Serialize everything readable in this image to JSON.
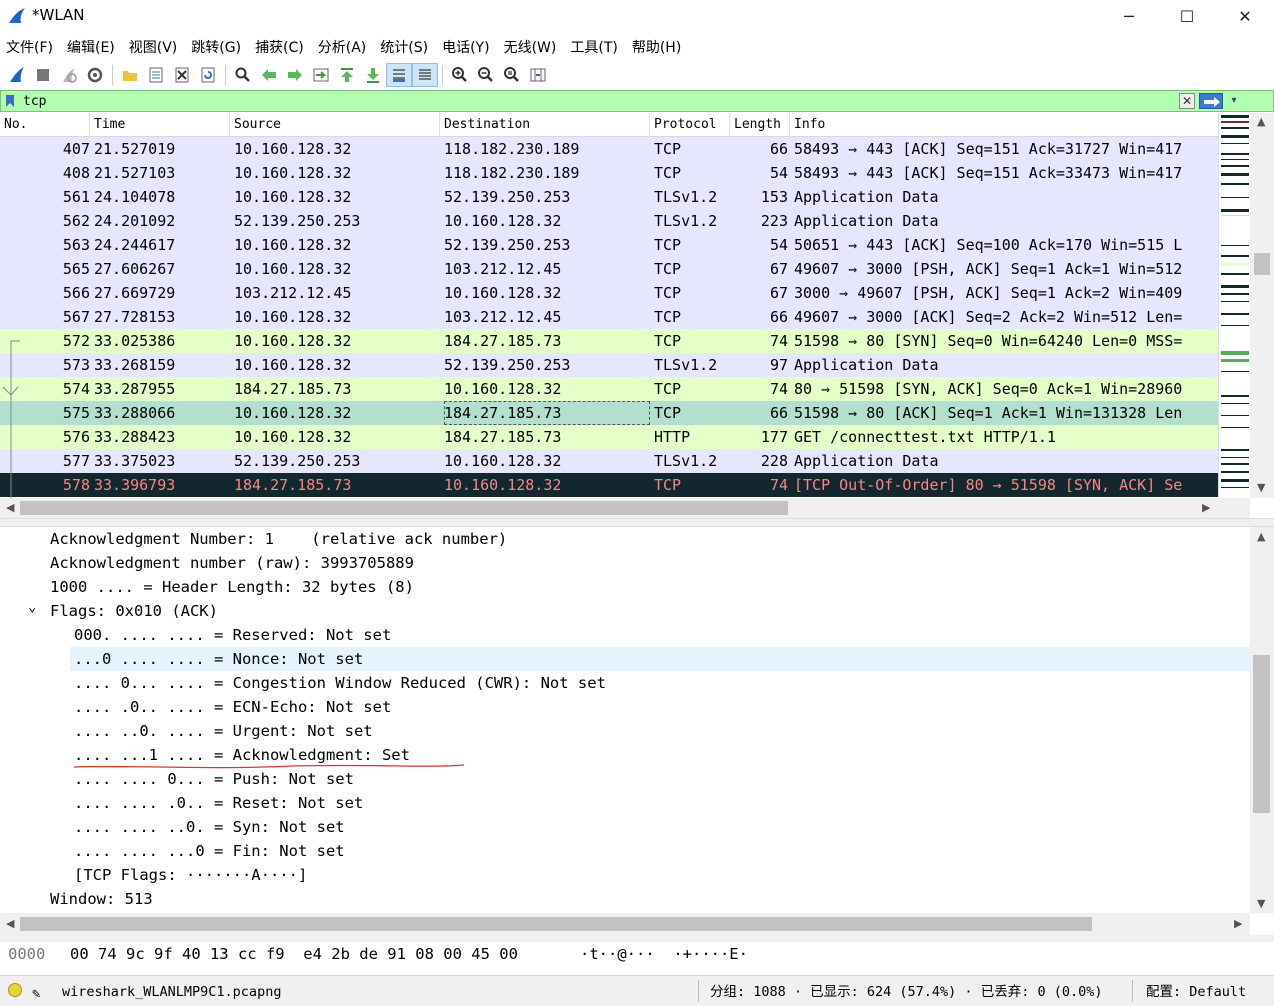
{
  "window": {
    "title": "*WLAN",
    "minimize": "─",
    "maximize": "☐",
    "close": "✕"
  },
  "menu": [
    "文件(F)",
    "编辑(E)",
    "视图(V)",
    "跳转(G)",
    "捕获(C)",
    "分析(A)",
    "统计(S)",
    "电话(Y)",
    "无线(W)",
    "工具(T)",
    "帮助(H)"
  ],
  "toolbar": [
    "shark-fin-start-icon",
    "stop-square-icon",
    "restart-fin-icon",
    "capture-options-gear-icon",
    "open-folder-icon",
    "save-file-icon",
    "close-file-icon",
    "reload-icon",
    "find-magnifier-icon",
    "go-back-arrow-icon",
    "go-forward-arrow-icon",
    "go-to-packet-icon",
    "go-first-icon",
    "go-last-icon",
    "autoscroll-icon",
    "colorize-icon",
    "zoom-in-icon",
    "zoom-out-icon",
    "zoom-normal-icon",
    "resize-columns-icon"
  ],
  "filter": {
    "value": "tcp",
    "clear": "✕",
    "dropdown": "▾"
  },
  "columns": [
    "No.",
    "Time",
    "Source",
    "Destination",
    "Protocol",
    "Length",
    "Info"
  ],
  "packets": [
    {
      "no": "407",
      "time": "21.527019",
      "src": "10.160.128.32",
      "dst": "118.182.230.189",
      "proto": "TCP",
      "len": "66",
      "info": "58493 → 443 [ACK] Seq=151 Ack=31727 Win=417",
      "cls": "r-tcp"
    },
    {
      "no": "408",
      "time": "21.527103",
      "src": "10.160.128.32",
      "dst": "118.182.230.189",
      "proto": "TCP",
      "len": "54",
      "info": "58493 → 443 [ACK] Seq=151 Ack=33473 Win=417",
      "cls": "r-tcp"
    },
    {
      "no": "561",
      "time": "24.104078",
      "src": "10.160.128.32",
      "dst": "52.139.250.253",
      "proto": "TLSv1.2",
      "len": "153",
      "info": "Application Data",
      "cls": "r-tls"
    },
    {
      "no": "562",
      "time": "24.201092",
      "src": "52.139.250.253",
      "dst": "10.160.128.32",
      "proto": "TLSv1.2",
      "len": "223",
      "info": "Application Data",
      "cls": "r-tls"
    },
    {
      "no": "563",
      "time": "24.244617",
      "src": "10.160.128.32",
      "dst": "52.139.250.253",
      "proto": "TCP",
      "len": "54",
      "info": "50651 → 443 [ACK] Seq=100 Ack=170 Win=515 L",
      "cls": "r-tcp"
    },
    {
      "no": "565",
      "time": "27.606267",
      "src": "10.160.128.32",
      "dst": "103.212.12.45",
      "proto": "TCP",
      "len": "67",
      "info": "49607 → 3000 [PSH, ACK] Seq=1 Ack=1 Win=512",
      "cls": "r-tcp"
    },
    {
      "no": "566",
      "time": "27.669729",
      "src": "103.212.12.45",
      "dst": "10.160.128.32",
      "proto": "TCP",
      "len": "67",
      "info": "3000 → 49607 [PSH, ACK] Seq=1 Ack=2 Win=409",
      "cls": "r-tcp"
    },
    {
      "no": "567",
      "time": "27.728153",
      "src": "10.160.128.32",
      "dst": "103.212.12.45",
      "proto": "TCP",
      "len": "66",
      "info": "49607 → 3000 [ACK] Seq=2 Ack=2 Win=512 Len=",
      "cls": "r-tcp"
    },
    {
      "no": "572",
      "time": "33.025386",
      "src": "10.160.128.32",
      "dst": "184.27.185.73",
      "proto": "TCP",
      "len": "74",
      "info": "51598 → 80 [SYN] Seq=0 Win=64240 Len=0 MSS=",
      "cls": "r-syn"
    },
    {
      "no": "573",
      "time": "33.268159",
      "src": "10.160.128.32",
      "dst": "52.139.250.253",
      "proto": "TLSv1.2",
      "len": "97",
      "info": "Application Data",
      "cls": "r-tls"
    },
    {
      "no": "574",
      "time": "33.287955",
      "src": "184.27.185.73",
      "dst": "10.160.128.32",
      "proto": "TCP",
      "len": "74",
      "info": "80 → 51598 [SYN, ACK] Seq=0 Ack=1 Win=28960",
      "cls": "r-syn"
    },
    {
      "no": "575",
      "time": "33.288066",
      "src": "10.160.128.32",
      "dst": "184.27.185.73",
      "proto": "TCP",
      "len": "66",
      "info": "51598 → 80 [ACK] Seq=1 Ack=1 Win=131328 Len",
      "cls": "r-sel"
    },
    {
      "no": "576",
      "time": "33.288423",
      "src": "10.160.128.32",
      "dst": "184.27.185.73",
      "proto": "HTTP",
      "len": "177",
      "info": "GET /connecttest.txt HTTP/1.1",
      "cls": "r-http"
    },
    {
      "no": "577",
      "time": "33.375023",
      "src": "52.139.250.253",
      "dst": "10.160.128.32",
      "proto": "TLSv1.2",
      "len": "228",
      "info": "Application Data",
      "cls": "r-tls"
    },
    {
      "no": "578",
      "time": "33.396793",
      "src": "184.27.185.73",
      "dst": "10.160.128.32",
      "proto": "TCP",
      "len": "74",
      "info": "[TCP Out-Of-Order] 80 → 51598 [SYN, ACK] Se",
      "cls": "r-bad"
    }
  ],
  "details": [
    {
      "text": "Acknowledgment Number: 1    (relative ack number)",
      "indent": 0
    },
    {
      "text": "Acknowledgment number (raw): 3993705889",
      "indent": 0
    },
    {
      "text": "1000 .... = Header Length: 32 bytes (8)",
      "indent": 0
    },
    {
      "text": "Flags: 0x010 (ACK)",
      "indent": 0,
      "expander": "⌄"
    },
    {
      "text": "000. .... .... = Reserved: Not set",
      "indent": 1
    },
    {
      "text": "...0 .... .... = Nonce: Not set",
      "indent": 1,
      "hl": true
    },
    {
      "text": ".... 0... .... = Congestion Window Reduced (CWR): Not set",
      "indent": 1
    },
    {
      "text": ".... .0.. .... = ECN-Echo: Not set",
      "indent": 1
    },
    {
      "text": ".... ..0. .... = Urgent: Not set",
      "indent": 1
    },
    {
      "text": ".... ...1 .... = Acknowledgment: Set",
      "indent": 1,
      "underline": true
    },
    {
      "text": ".... .... 0... = Push: Not set",
      "indent": 1
    },
    {
      "text": ".... .... .0.. = Reset: Not set",
      "indent": 1
    },
    {
      "text": ".... .... ..0. = Syn: Not set",
      "indent": 1
    },
    {
      "text": ".... .... ...0 = Fin: Not set",
      "indent": 1
    },
    {
      "text": "[TCP Flags: ·······A····]",
      "indent": 1
    },
    {
      "text": "Window: 513",
      "indent": 0
    }
  ],
  "bytes": {
    "offset": "0000",
    "hex": "00 74 9c 9f 40 13 cc f9  e4 2b de 91 08 00 45 00",
    "ascii": "·t··@···  ·+····E·"
  },
  "status": {
    "file": "wireshark_WLANLMP9C1.pcapng",
    "packets": "分组: 1088 · 已显示: 624 (57.4%) · 已丢弃: 0 (0.0%)",
    "profile": "配置: Default"
  },
  "colors": {
    "tcp_row": "#e7e6ff",
    "syn_row": "#e4ffc7",
    "selected_row": "#b3dfcf",
    "bad_row": "#12272e",
    "filter_ok": "#afffaf"
  }
}
